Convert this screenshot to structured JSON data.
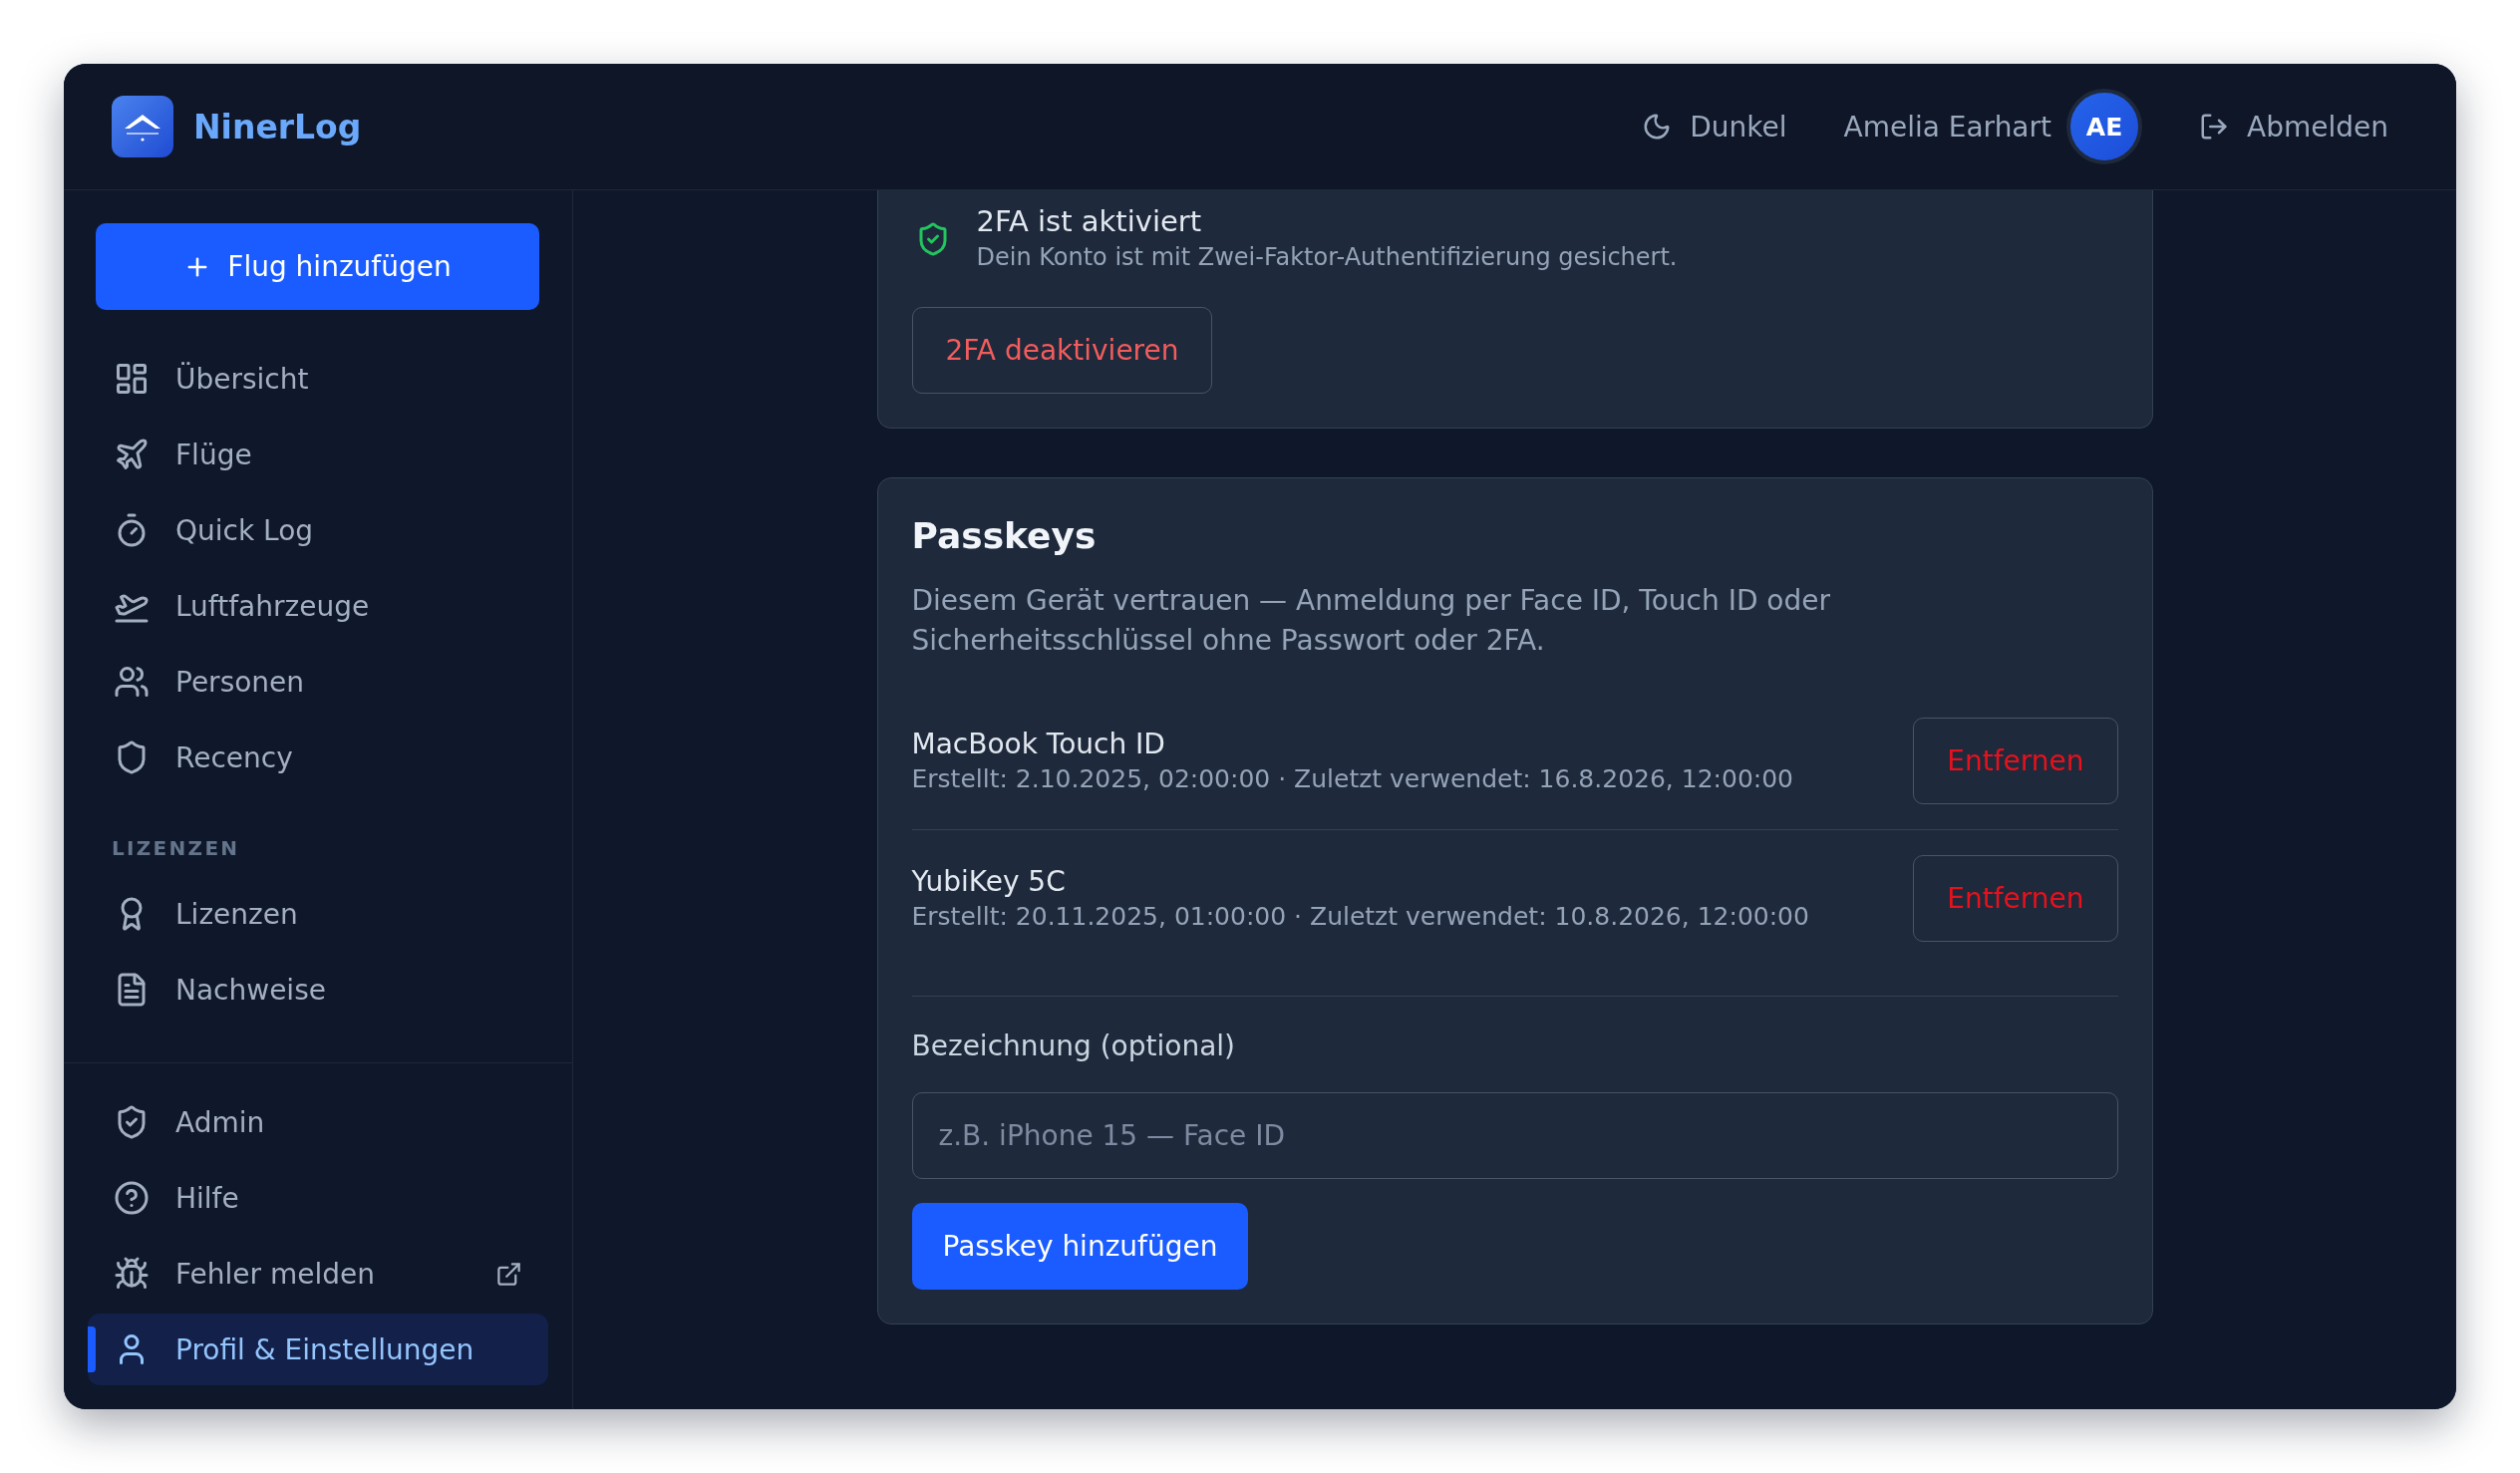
{
  "app": {
    "name": "NinerLog"
  },
  "header": {
    "theme_toggle": "Dunkel",
    "user": {
      "name": "Amelia Earhart",
      "initials": "AE"
    },
    "logout": "Abmelden"
  },
  "sidebar": {
    "primary_action": "Flug hinzufügen",
    "sections": [
      {
        "items": [
          {
            "label": "Übersicht",
            "selected": false
          },
          {
            "label": "Flüge",
            "selected": false
          },
          {
            "label": "Quick Log",
            "selected": false
          },
          {
            "label": "Luftfahrzeuge",
            "selected": false
          },
          {
            "label": "Personen",
            "selected": false
          },
          {
            "label": "Recency",
            "selected": false
          }
        ]
      },
      {
        "title": "LIZENZEN",
        "items": [
          {
            "label": "Lizenzen",
            "selected": false
          },
          {
            "label": "Nachweise",
            "selected": false
          }
        ]
      }
    ],
    "footer_items": [
      {
        "label": "Admin",
        "selected": false,
        "external": false
      },
      {
        "label": "Hilfe",
        "selected": false,
        "external": false
      },
      {
        "label": "Fehler melden",
        "selected": false,
        "external": true
      },
      {
        "label": "Profil & Einstellungen",
        "selected": true,
        "external": false
      }
    ]
  },
  "two_factor": {
    "enabled": true,
    "status": "2FA ist aktiviert",
    "description": "Dein Konto ist mit Zwei-Faktor-Authentifizierung gesichert.",
    "action": "2FA deaktivieren"
  },
  "passkeys": {
    "title": "Passkeys",
    "description": "Diesem Gerät vertrauen — Anmeldung per Face ID, Touch ID oder Sicherheitsschlüssel ohne Passwort oder 2FA.",
    "items": [
      {
        "name": "MacBook Touch ID",
        "details": "Erstellt: 2.10.2025, 02:00:00 · Zuletzt verwendet: 16.8.2026, 12:00:00",
        "action": "Entfernen"
      },
      {
        "name": "YubiKey 5C",
        "details": "Erstellt: 20.11.2025, 01:00:00 · Zuletzt verwendet: 10.8.2026, 12:00:00",
        "action": "Entfernen"
      }
    ],
    "form": {
      "label": "Bezeichnung (optional)",
      "placeholder": "z.B. iPhone 15 — Face ID",
      "submit": "Passkey hinzufügen"
    }
  }
}
